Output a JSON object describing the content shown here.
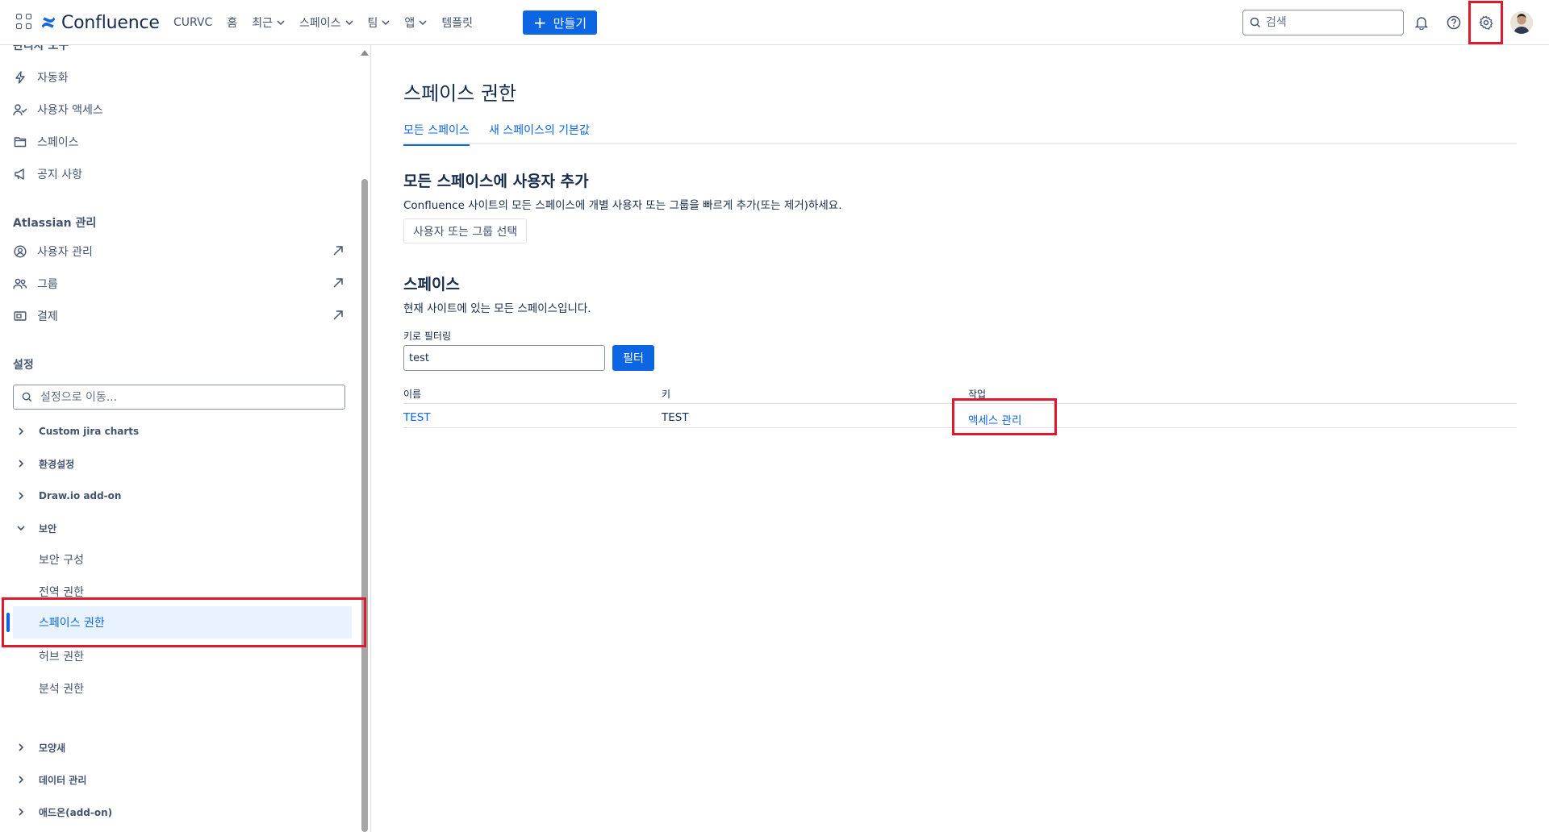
{
  "topnav": {
    "logo_text": "Confluence",
    "items": [
      {
        "label": "CURVC",
        "dropdown": false
      },
      {
        "label": "홈",
        "dropdown": false
      },
      {
        "label": "최근",
        "dropdown": true
      },
      {
        "label": "스페이스",
        "dropdown": true
      },
      {
        "label": "팀",
        "dropdown": true
      },
      {
        "label": "앱",
        "dropdown": true
      },
      {
        "label": "템플릿",
        "dropdown": false
      }
    ],
    "create_label": "만들기",
    "search_placeholder": "검색"
  },
  "sidebar": {
    "cut_heading": "관리자 도구",
    "admin_tools": [
      {
        "label": "자동화",
        "icon": "lightning-icon"
      },
      {
        "label": "사용자 액세스",
        "icon": "user-access-icon"
      },
      {
        "label": "스페이스",
        "icon": "folder-icon"
      },
      {
        "label": "공지 사항",
        "icon": "megaphone-icon"
      }
    ],
    "atlassian_heading": "Atlassian 관리",
    "atlassian_items": [
      {
        "label": "사용자 관리",
        "icon": "person-circle-icon"
      },
      {
        "label": "그룹",
        "icon": "people-icon"
      },
      {
        "label": "결제",
        "icon": "billing-icon"
      }
    ],
    "settings_heading": "설정",
    "settings_search_placeholder": "설정으로 이동...",
    "tree_top": [
      {
        "label": "Custom jira charts",
        "expanded": false
      },
      {
        "label": "환경설정",
        "expanded": false
      },
      {
        "label": "Draw.io add-on",
        "expanded": false
      },
      {
        "label": "보안",
        "expanded": true
      }
    ],
    "security_children": [
      {
        "label": "보안 구성",
        "active": false
      },
      {
        "label": "전역 권한",
        "active": false
      },
      {
        "label": "스페이스 권한",
        "active": true
      },
      {
        "label": "허브 권한",
        "active": false
      },
      {
        "label": "분석 권한",
        "active": false
      }
    ],
    "tree_bottom": [
      {
        "label": "모양새",
        "expanded": false
      },
      {
        "label": "데이터 관리",
        "expanded": false
      },
      {
        "label": "애드온(add-on)",
        "expanded": false
      }
    ]
  },
  "main": {
    "title": "스페이스 권한",
    "tabs": [
      {
        "label": "모든 스페이스",
        "active": true
      },
      {
        "label": "새 스페이스의 기본값",
        "active": false
      }
    ],
    "add_section": {
      "title": "모든 스페이스에 사용자 추가",
      "desc": "Confluence 사이트의 모든 스페이스에 개별 사용자 또는 그룹을 빠르게 추가(또는 제거)하세요.",
      "button_label": "사용자 또는 그룹 선택"
    },
    "spaces_section": {
      "title": "스페이스",
      "desc": "현재 사이트에 있는 모든 스페이스입니다.",
      "filter_label": "키로 필터링",
      "filter_value": "test",
      "filter_button": "필터",
      "columns": [
        "이름",
        "키",
        "작업"
      ],
      "rows": [
        {
          "name": "TEST",
          "key": "TEST",
          "action": "액세스 관리"
        }
      ]
    }
  },
  "colors": {
    "brand": "#0c66e4",
    "highlight": "#e0182d",
    "text": "#172b4d",
    "subtle_text": "#44546f"
  }
}
